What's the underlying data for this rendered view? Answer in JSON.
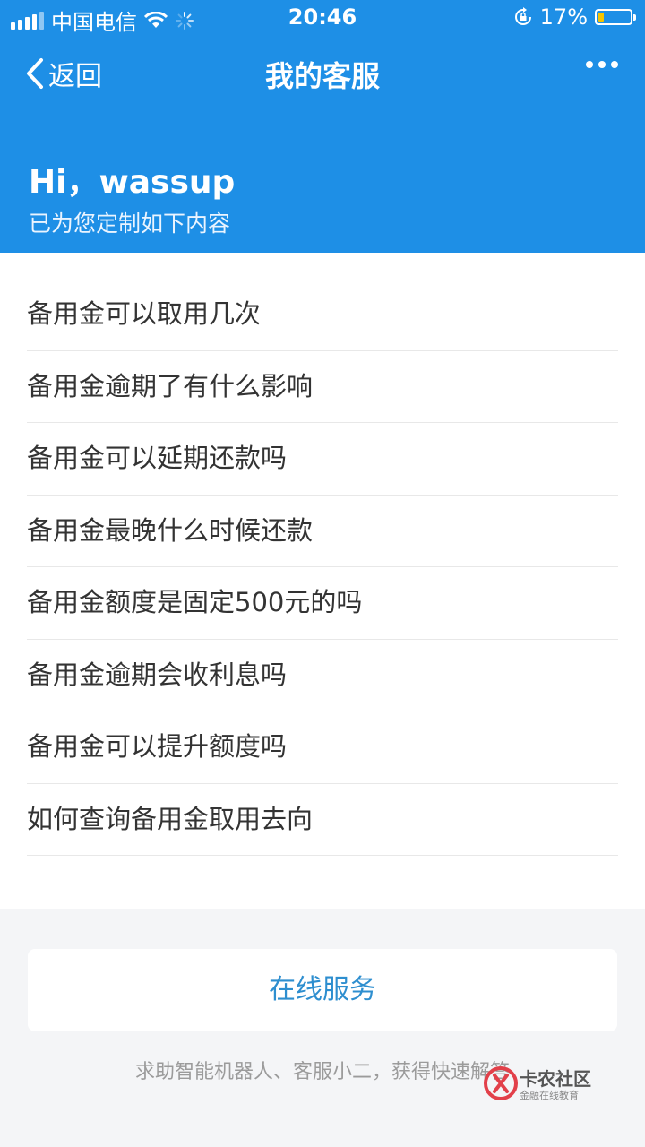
{
  "status_bar": {
    "carrier": "中国电信",
    "time": "20:46",
    "battery_percent": "17%",
    "battery_level": 0.17
  },
  "nav": {
    "back_label": "返回",
    "title": "我的客服"
  },
  "header": {
    "greeting": "Hi，wassup",
    "subtitle": "已为您定制如下内容"
  },
  "questions": [
    "备用金可以取用几次",
    "备用金逾期了有什么影响",
    "备用金可以延期还款吗",
    "备用金最晚什么时候还款",
    "备用金额度是固定500元的吗",
    "备用金逾期会收利息吗",
    "备用金可以提升额度吗",
    "如何查询备用金取用去向"
  ],
  "online_service": {
    "label": "在线服务",
    "hint": "求助智能机器人、客服小二，获得快速解答"
  },
  "watermark": {
    "title": "卡农社区",
    "subtitle": "金融在线教育"
  },
  "colors": {
    "primary": "#1e8fe6",
    "link": "#2d8ecf",
    "battery_fill": "#f5c400"
  }
}
